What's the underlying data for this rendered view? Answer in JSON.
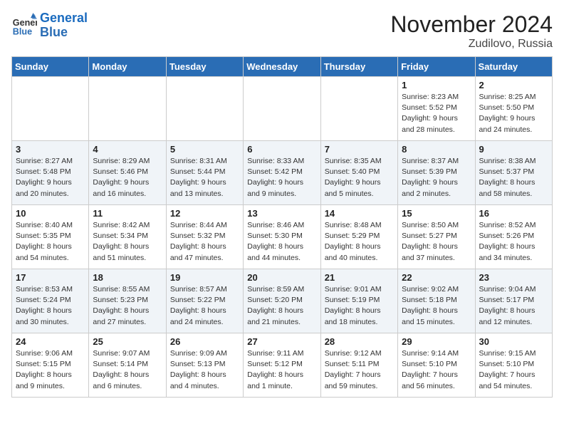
{
  "logo": {
    "line1": "General",
    "line2": "Blue"
  },
  "header": {
    "month": "November 2024",
    "location": "Zudilovo, Russia"
  },
  "weekdays": [
    "Sunday",
    "Monday",
    "Tuesday",
    "Wednesday",
    "Thursday",
    "Friday",
    "Saturday"
  ],
  "weeks": [
    [
      {
        "day": "",
        "info": ""
      },
      {
        "day": "",
        "info": ""
      },
      {
        "day": "",
        "info": ""
      },
      {
        "day": "",
        "info": ""
      },
      {
        "day": "",
        "info": ""
      },
      {
        "day": "1",
        "info": "Sunrise: 8:23 AM\nSunset: 5:52 PM\nDaylight: 9 hours\nand 28 minutes."
      },
      {
        "day": "2",
        "info": "Sunrise: 8:25 AM\nSunset: 5:50 PM\nDaylight: 9 hours\nand 24 minutes."
      }
    ],
    [
      {
        "day": "3",
        "info": "Sunrise: 8:27 AM\nSunset: 5:48 PM\nDaylight: 9 hours\nand 20 minutes."
      },
      {
        "day": "4",
        "info": "Sunrise: 8:29 AM\nSunset: 5:46 PM\nDaylight: 9 hours\nand 16 minutes."
      },
      {
        "day": "5",
        "info": "Sunrise: 8:31 AM\nSunset: 5:44 PM\nDaylight: 9 hours\nand 13 minutes."
      },
      {
        "day": "6",
        "info": "Sunrise: 8:33 AM\nSunset: 5:42 PM\nDaylight: 9 hours\nand 9 minutes."
      },
      {
        "day": "7",
        "info": "Sunrise: 8:35 AM\nSunset: 5:40 PM\nDaylight: 9 hours\nand 5 minutes."
      },
      {
        "day": "8",
        "info": "Sunrise: 8:37 AM\nSunset: 5:39 PM\nDaylight: 9 hours\nand 2 minutes."
      },
      {
        "day": "9",
        "info": "Sunrise: 8:38 AM\nSunset: 5:37 PM\nDaylight: 8 hours\nand 58 minutes."
      }
    ],
    [
      {
        "day": "10",
        "info": "Sunrise: 8:40 AM\nSunset: 5:35 PM\nDaylight: 8 hours\nand 54 minutes."
      },
      {
        "day": "11",
        "info": "Sunrise: 8:42 AM\nSunset: 5:34 PM\nDaylight: 8 hours\nand 51 minutes."
      },
      {
        "day": "12",
        "info": "Sunrise: 8:44 AM\nSunset: 5:32 PM\nDaylight: 8 hours\nand 47 minutes."
      },
      {
        "day": "13",
        "info": "Sunrise: 8:46 AM\nSunset: 5:30 PM\nDaylight: 8 hours\nand 44 minutes."
      },
      {
        "day": "14",
        "info": "Sunrise: 8:48 AM\nSunset: 5:29 PM\nDaylight: 8 hours\nand 40 minutes."
      },
      {
        "day": "15",
        "info": "Sunrise: 8:50 AM\nSunset: 5:27 PM\nDaylight: 8 hours\nand 37 minutes."
      },
      {
        "day": "16",
        "info": "Sunrise: 8:52 AM\nSunset: 5:26 PM\nDaylight: 8 hours\nand 34 minutes."
      }
    ],
    [
      {
        "day": "17",
        "info": "Sunrise: 8:53 AM\nSunset: 5:24 PM\nDaylight: 8 hours\nand 30 minutes."
      },
      {
        "day": "18",
        "info": "Sunrise: 8:55 AM\nSunset: 5:23 PM\nDaylight: 8 hours\nand 27 minutes."
      },
      {
        "day": "19",
        "info": "Sunrise: 8:57 AM\nSunset: 5:22 PM\nDaylight: 8 hours\nand 24 minutes."
      },
      {
        "day": "20",
        "info": "Sunrise: 8:59 AM\nSunset: 5:20 PM\nDaylight: 8 hours\nand 21 minutes."
      },
      {
        "day": "21",
        "info": "Sunrise: 9:01 AM\nSunset: 5:19 PM\nDaylight: 8 hours\nand 18 minutes."
      },
      {
        "day": "22",
        "info": "Sunrise: 9:02 AM\nSunset: 5:18 PM\nDaylight: 8 hours\nand 15 minutes."
      },
      {
        "day": "23",
        "info": "Sunrise: 9:04 AM\nSunset: 5:17 PM\nDaylight: 8 hours\nand 12 minutes."
      }
    ],
    [
      {
        "day": "24",
        "info": "Sunrise: 9:06 AM\nSunset: 5:15 PM\nDaylight: 8 hours\nand 9 minutes."
      },
      {
        "day": "25",
        "info": "Sunrise: 9:07 AM\nSunset: 5:14 PM\nDaylight: 8 hours\nand 6 minutes."
      },
      {
        "day": "26",
        "info": "Sunrise: 9:09 AM\nSunset: 5:13 PM\nDaylight: 8 hours\nand 4 minutes."
      },
      {
        "day": "27",
        "info": "Sunrise: 9:11 AM\nSunset: 5:12 PM\nDaylight: 8 hours\nand 1 minute."
      },
      {
        "day": "28",
        "info": "Sunrise: 9:12 AM\nSunset: 5:11 PM\nDaylight: 7 hours\nand 59 minutes."
      },
      {
        "day": "29",
        "info": "Sunrise: 9:14 AM\nSunset: 5:10 PM\nDaylight: 7 hours\nand 56 minutes."
      },
      {
        "day": "30",
        "info": "Sunrise: 9:15 AM\nSunset: 5:10 PM\nDaylight: 7 hours\nand 54 minutes."
      }
    ]
  ]
}
